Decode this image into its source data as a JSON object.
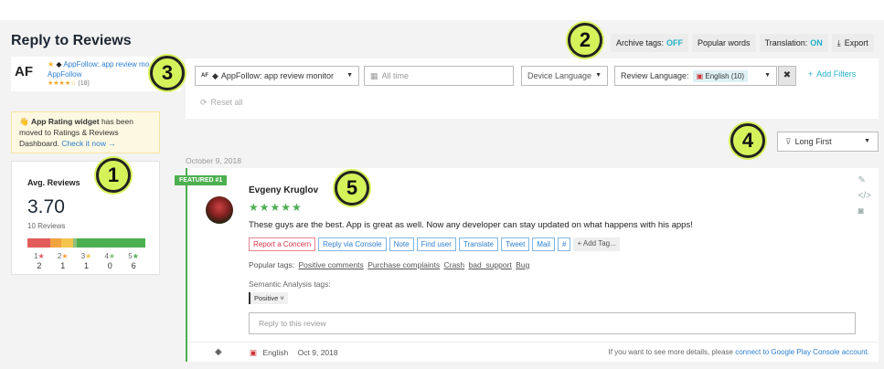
{
  "page_title": "Reply to Reviews",
  "top_buttons": {
    "archive_tags": "Archive tags:",
    "archive_state": "OFF",
    "popular_words": "Popular words",
    "translation": "Translation:",
    "translation_state": "ON",
    "export": "Export"
  },
  "app_card": {
    "logo": "AF",
    "name": "AppFollow: app review mo",
    "publisher": "AppFollow",
    "stars": "★★★★☆",
    "rating_count": "(18)"
  },
  "filters": {
    "app_select": "AppFollow: app review monitor",
    "app_badge": "AF",
    "date_select": "All time",
    "device_language": "Device Language",
    "review_language_label": "Review Language:",
    "review_language_value": "English (10)",
    "add_filters": "Add Filters",
    "reset_all": "Reset all"
  },
  "widget_notice": {
    "bold": "App Rating widget",
    "text": " has been moved to Ratings & Reviews Dashboard. ",
    "link": "Check it now →"
  },
  "avg_reviews": {
    "title": "Avg. Reviews",
    "value": "3.70",
    "count": "10 Reviews",
    "stars": [
      {
        "label": "1★",
        "value": "2",
        "color": "#e25c5c"
      },
      {
        "label": "2★",
        "value": "1",
        "color": "#f1a340"
      },
      {
        "label": "3★",
        "value": "1",
        "color": "#f3c44e"
      },
      {
        "label": "4★",
        "value": "0",
        "color": "#8bc07a"
      },
      {
        "label": "5★",
        "value": "6",
        "color": "#4caf50"
      }
    ]
  },
  "date_label": "October 9, 2018",
  "sort": {
    "value": "Long First"
  },
  "review": {
    "featured": "FEATURED #1",
    "author": "Evgeny Kruglov",
    "stars": "★★★★★",
    "text": "These guys are the best. App is great as well. Now any developer can stay updated on what happens with his apps!",
    "actions": [
      "Report a Concern",
      "Reply via Console",
      "Note",
      "Find user",
      "Translate",
      "Tweet",
      "Mail",
      "#"
    ],
    "add_tag": "+ Add Tag...",
    "popular_tags_label": "Popular tags:",
    "popular_tags": [
      "Positive comments",
      "Purchase complaints",
      "Crash",
      "bad_support",
      "Bug"
    ],
    "semantic_label": "Semantic Analysis tags:",
    "semantic_tag": "Positive ˅",
    "reply_placeholder": "Reply to this review",
    "language": "English",
    "date": "Oct 9, 2018",
    "footer_note": "If you want to see more details, please ",
    "footer_link": "connect to Google Play Console account."
  },
  "callouts": [
    "1",
    "2",
    "3",
    "4",
    "5"
  ],
  "colors": {
    "accent": "#23b0c6",
    "featured": "#4caf50",
    "callout": "#d6f25a"
  }
}
